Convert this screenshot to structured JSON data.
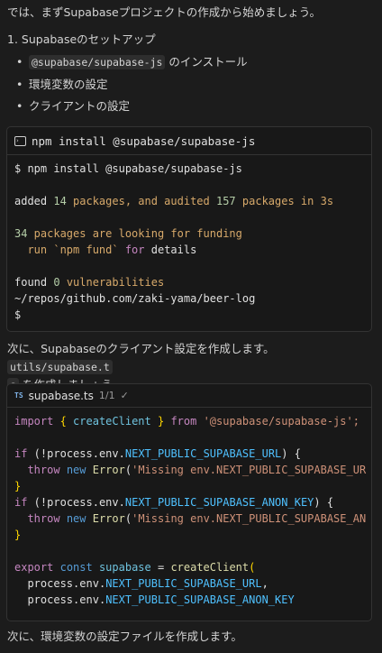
{
  "intro": "では、まずSupabaseプロジェクトの作成から始めましょう。",
  "step1_title": "1. Supabaseのセットアップ",
  "bullets": [
    {
      "code": "@supabase/supabase-js",
      "text": " のインストール"
    },
    {
      "text": "環境変数の設定"
    },
    {
      "text": "クライアントの設定"
    }
  ],
  "terminal": {
    "title": "npm install @supabase/supabase-js",
    "cmd": "$ npm install @supabase/supabase-js",
    "added_prefix": "added ",
    "added_n1": "14",
    "added_mid": " packages, and audited ",
    "added_n2": "157",
    "added_suffix": " packages in 3s",
    "fund_n": "34",
    "fund_rest": " packages are looking for funding",
    "fund2_a": "  run `npm fund` ",
    "fund2_b": "for",
    "fund2_c": " details",
    "found_a": "found ",
    "found_n": "0",
    "found_b": " vulnerabilities",
    "path": "~/repos/github.com/zaki-yama/beer-log",
    "prompt": "$"
  },
  "para2_a": "次に、Supabaseのクライアント設定を作成します。",
  "para2_code1": "utils/supabase.t",
  "para2_code2": "s",
  "para2_b": " を作成しましょう。",
  "file": {
    "icon_text": "TS",
    "name": "supabase.ts",
    "count": "1/1",
    "check": "✓"
  },
  "code": {
    "l1": [
      "import",
      " { ",
      "createClient",
      " } ",
      "from",
      " '@supabase/supabase-js';"
    ],
    "l3": [
      "if",
      " (!",
      "process",
      ".",
      "env",
      ".",
      "NEXT_PUBLIC_SUPABASE_URL",
      ") {"
    ],
    "l4": [
      "  ",
      "throw",
      " ",
      "new",
      " ",
      "Error",
      "(",
      "'Missing env.NEXT_PUBLIC_SUPABASE_UR"
    ],
    "l5": [
      "}"
    ],
    "l6": [
      "if",
      " (!",
      "process",
      ".",
      "env",
      ".",
      "NEXT_PUBLIC_SUPABASE_ANON_KEY",
      ") {"
    ],
    "l7": [
      "  ",
      "throw",
      " ",
      "new",
      " ",
      "Error",
      "(",
      "'Missing env.NEXT_PUBLIC_SUPABASE_AN"
    ],
    "l8": [
      "}"
    ],
    "l10": [
      "export",
      " ",
      "const",
      " ",
      "supabase",
      " = ",
      "createClient",
      "("
    ],
    "l11": [
      "  ",
      "process",
      ".",
      "env",
      ".",
      "NEXT_PUBLIC_SUPABASE_URL",
      ","
    ],
    "l12": [
      "  ",
      "process",
      ".",
      "env",
      ".",
      "NEXT_PUBLIC_SUPABASE_ANON_KEY"
    ]
  },
  "para3": "次に、環境変数の設定ファイルを作成します。"
}
